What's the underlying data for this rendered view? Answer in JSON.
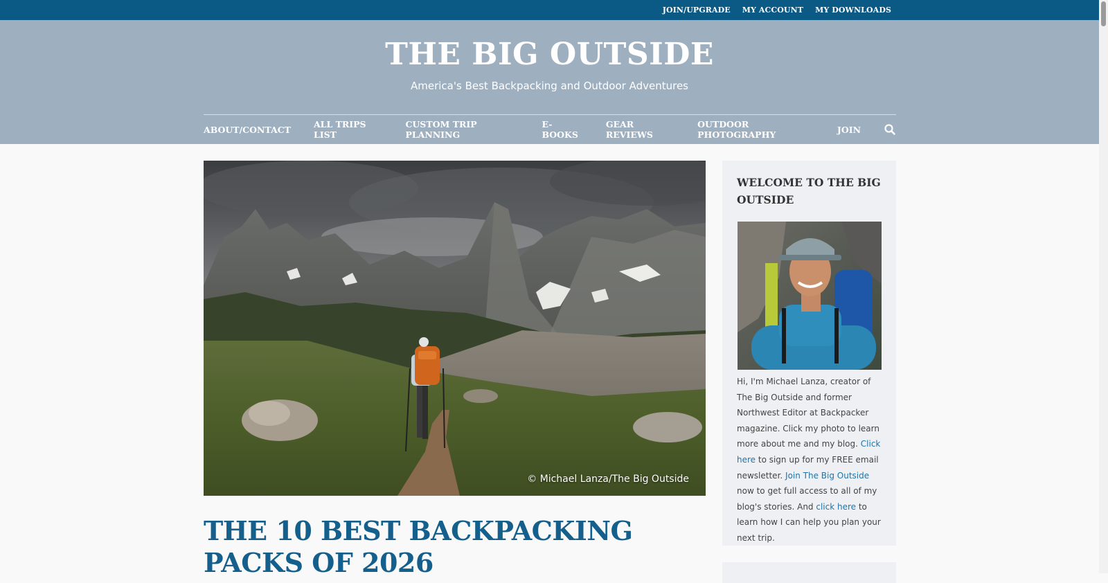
{
  "topbar": {
    "links": [
      "JOIN/UPGRADE",
      "MY ACCOUNT",
      "MY DOWNLOADS"
    ]
  },
  "header": {
    "title": "THE BIG OUTSIDE",
    "tagline": "America's Best Backpacking and Outdoor Adventures"
  },
  "nav": {
    "items": [
      "ABOUT/CONTACT",
      "ALL TRIPS LIST",
      "CUSTOM TRIP PLANNING",
      "E-BOOKS",
      "GEAR REVIEWS",
      "OUTDOOR PHOTOGRAPHY",
      "JOIN"
    ],
    "search_icon": "search-icon"
  },
  "main": {
    "hero_credit": "© Michael Lanza/The Big Outside",
    "post_title": "THE 10 BEST BACKPACKING PACKS OF 2026"
  },
  "sidebar": {
    "widget_title": "WELCOME TO THE BIG OUTSIDE",
    "bio_1": "Hi, I'm Michael Lanza, creator of The Big Outside and former Northwest Editor at Backpacker magazine. Click my photo to learn more about me and my blog. ",
    "link_1": "Click here",
    "bio_2": " to sign up for my FREE email newsletter. ",
    "link_2": "Join The Big Outside",
    "bio_3": " now to get full access to all of my blog's stories. And ",
    "link_3": "click here",
    "bio_4": " to learn how I can help you plan your next trip."
  },
  "colors": {
    "topbar": "#0b5a85",
    "header": "#9eafc0",
    "title_blue": "#145f8c",
    "link_blue": "#1f74a8"
  }
}
